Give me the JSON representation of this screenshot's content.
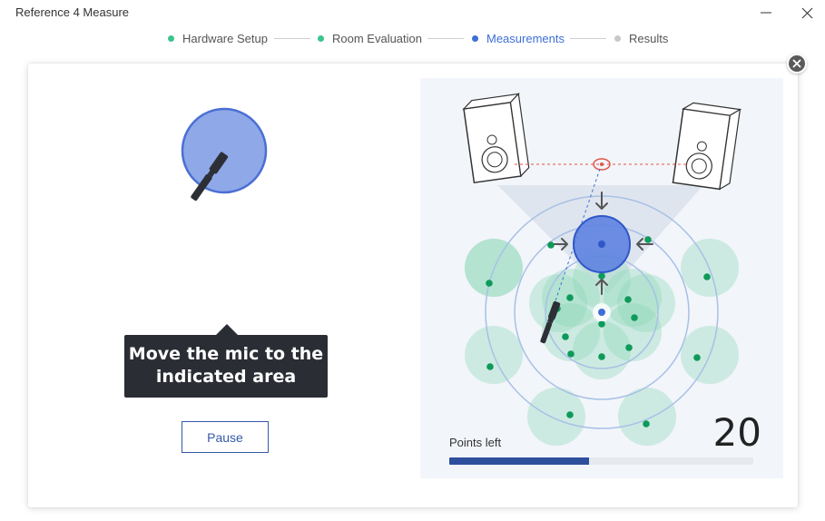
{
  "app": {
    "title": "Reference 4 Measure"
  },
  "window_controls": {
    "minimize_icon": "minimize-icon",
    "close_icon": "close-icon"
  },
  "steps": [
    {
      "label": "Hardware Setup",
      "state": "done",
      "color": "#3cc48c"
    },
    {
      "label": "Room Evaluation",
      "state": "done",
      "color": "#3cc48c"
    },
    {
      "label": "Measurements",
      "state": "active",
      "color": "#3d6fd6"
    },
    {
      "label": "Results",
      "state": "pending",
      "color": "#c8c8cc"
    }
  ],
  "instruction": {
    "line1": "Move the mic to the",
    "line2": "indicated area"
  },
  "pause_label": "Pause",
  "points": {
    "label": "Points left",
    "count": "20",
    "progress": 0.46
  },
  "colors": {
    "accent": "#3d6fd6",
    "target": "#5b7fe0",
    "zone": "#8ed8b8",
    "zone_point": "#0e9a5a",
    "progress": "#2e4f9c"
  }
}
